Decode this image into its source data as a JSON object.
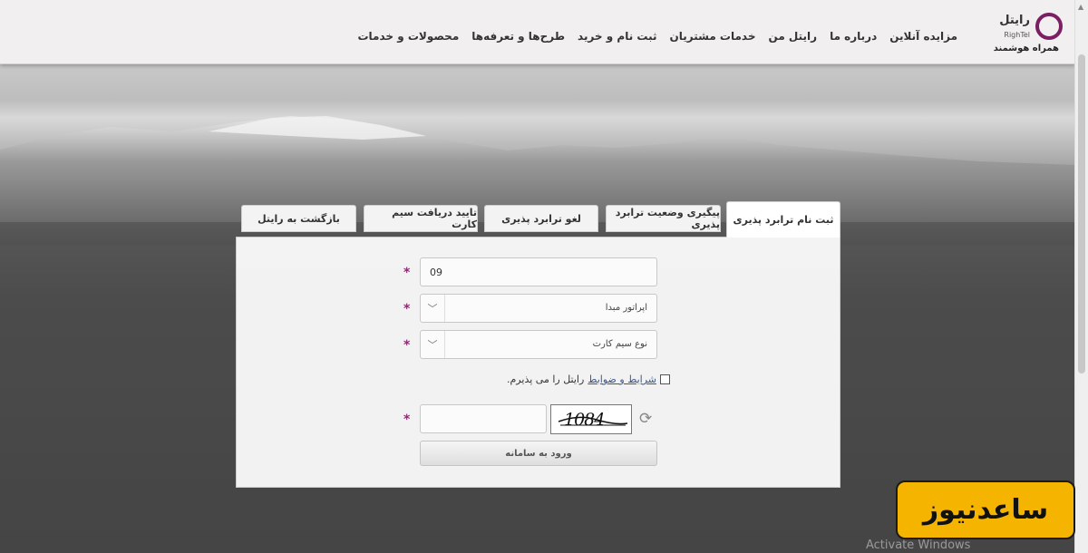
{
  "header": {
    "logo": {
      "name": "رایتل",
      "name_en": "RighTel",
      "slogan": "همراه هوشمند",
      "ring_color": "#7a1f63"
    },
    "nav": [
      "محصولات و خدمات",
      "طرح‌ها و تعرفه‌ها",
      "ثبت نام و خرید",
      "خدمات مشتریان",
      "رایتل من",
      "درباره ما",
      "مزایده آنلاین"
    ]
  },
  "tabs": [
    {
      "label": "ثبت نام ترابرد پذیری",
      "active": true
    },
    {
      "label": "پیگیری وضعیت ترابرد پذیری",
      "active": false
    },
    {
      "label": "لغو ترابرد پذیری",
      "active": false
    },
    {
      "label": "تایید دریافت سیم کارت",
      "active": false
    },
    {
      "label": "بازگشت به رایتل",
      "active": false
    }
  ],
  "form": {
    "required_marker": "*",
    "phone_value": "09",
    "operator_select": "اپراتور مبدا",
    "sim_type_select": "نوع سیم کارت",
    "terms_link": "شرایط و ضوابط",
    "terms_text": "رایتل را می پذیرم.",
    "captcha_value": "",
    "captcha_image_text": "1084",
    "submit_label": "ورود به سامانه"
  },
  "accent_color": "#8a2c72",
  "watermark": {
    "text": "ساعدنیوز",
    "color": "#f5b400"
  },
  "os_overlay": "Activate Windows"
}
